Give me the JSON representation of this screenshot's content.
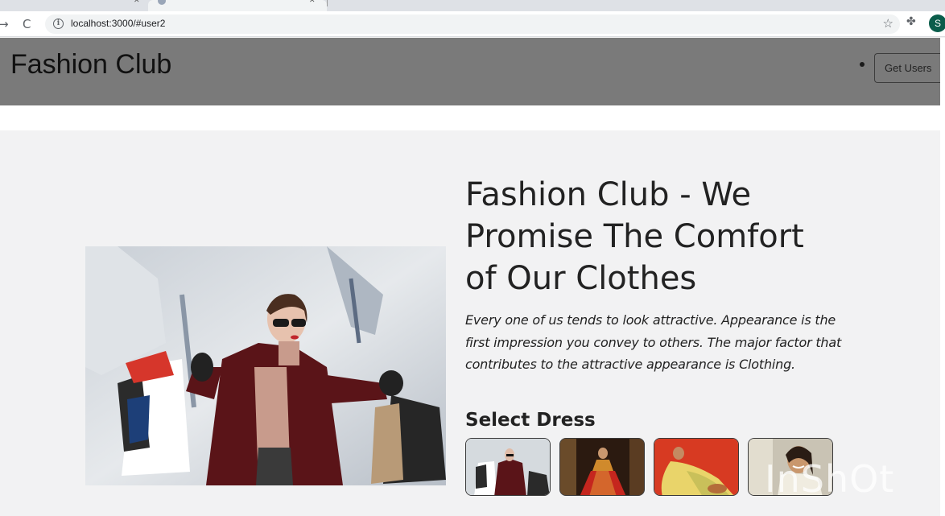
{
  "browser": {
    "address_url": "localhost:3000/#user2",
    "profile_initial": "S"
  },
  "site": {
    "brand": "Fashion Club",
    "nav_button_label": "Get Users"
  },
  "hero": {
    "headline": "Fashion Club - We Promise The Comfort of Our Clothes",
    "body": "Every one of us tends to look attractive. Appearance is the first impression you convey to others. The major factor that contributes to the attractive appearance is Clothing.",
    "select_title": "Select Dress"
  },
  "thumbnails": [
    {
      "name": "shopping-bags-woman"
    },
    {
      "name": "red-lehenga-dress"
    },
    {
      "name": "yellow-saree-dress"
    },
    {
      "name": "smiling-woman-portrait"
    }
  ],
  "watermark": "InShOt",
  "colors": {
    "header_bg": "#7a7a7a",
    "page_bg": "#f2f2f3",
    "text": "#222222"
  }
}
